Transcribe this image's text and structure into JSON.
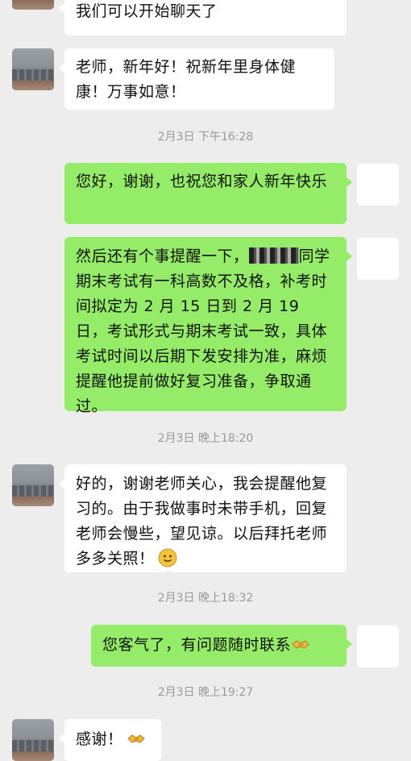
{
  "messages": [
    {
      "text": "我们可以开始聊天了"
    },
    {
      "text": "老师，新年好！祝新年里身体健康！万事如意！"
    },
    {
      "text": "您好，谢谢，也祝您和家人新年快乐"
    },
    {
      "text_before": "然后还有个事提醒一下，",
      "text_after": "同学期末考试有一科高数不及格，补考时间拟定为 2 月 15 日到 2 月 19 日，考试形式与期末考试一致，具体考试时间以后期下发安排为准，麻烦提醒他提前做好复习准备，争取通过。"
    },
    {
      "text": "好的，谢谢老师关心，我会提醒他复习的。由于我做事时未带手机，回复老师会慢些，望见谅。以后拜托老师多多关照！"
    },
    {
      "text": "您客气了，有问题随时联系"
    },
    {
      "text": "感谢！"
    }
  ],
  "timestamps": [
    "2月3日 下午16:28",
    "2月3日 晚上18:20",
    "2月3日 晚上18:32",
    "2月3日 晚上19:27"
  ],
  "colors": {
    "background": "#ededed",
    "incoming_bubble": "#ffffff",
    "outgoing_bubble": "#95ec69",
    "timestamp_text": "#999999"
  },
  "icons": [
    "smile-emoji",
    "handshake-emoji"
  ]
}
